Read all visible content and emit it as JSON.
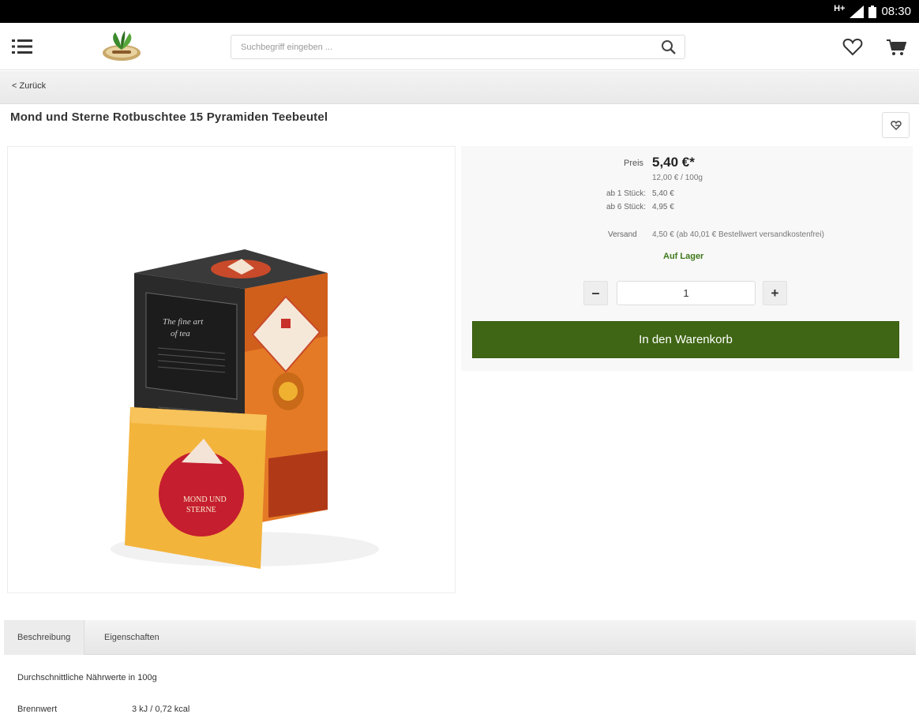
{
  "status_bar": {
    "network": "H+",
    "time": "08:30"
  },
  "search": {
    "placeholder": "Suchbegriff eingeben ..."
  },
  "nav": {
    "back_label": "< Zurück"
  },
  "product": {
    "title": "Mond und Sterne Rotbuschtee 15 Pyramiden Teebeutel",
    "image_text": {
      "box_line1": "The fine art",
      "box_line2": "of tea",
      "bag_line1": "MOND UND",
      "bag_line2": "STERNE"
    }
  },
  "pricing": {
    "price_label": "Preis",
    "price": "5,40 €*",
    "reference_price": "12,00 € / 100g",
    "tiers": [
      {
        "label": "ab 1 Stück:",
        "value": "5,40 €"
      },
      {
        "label": "ab 6 Stück:",
        "value": "4,95 €"
      }
    ],
    "shipping_label": "Versand",
    "shipping_value": "4,50 € (ab 40,01 € Bestellwert versandkostenfrei)",
    "stock_status": "Auf Lager"
  },
  "quantity": {
    "minus": "–",
    "value": "1",
    "plus": "+"
  },
  "cart_button_label": "In den Warenkorb",
  "tabs": [
    {
      "label": "Beschreibung",
      "active": true
    },
    {
      "label": "Eigenschaften",
      "active": false
    }
  ],
  "description": {
    "heading": "Durchschnittliche Nährwerte in 100g",
    "rows": [
      {
        "label": "Brennwert",
        "value": "3 kJ / 0,72 kcal"
      }
    ]
  },
  "colors": {
    "cart_button": "#3f6614",
    "stock_green": "#3f7a1a",
    "status_bar": "#000000"
  },
  "icons": [
    "menu-icon",
    "logo",
    "search-icon",
    "heart-icon",
    "cart-icon",
    "note-icon",
    "signal-icon",
    "battery-icon"
  ]
}
